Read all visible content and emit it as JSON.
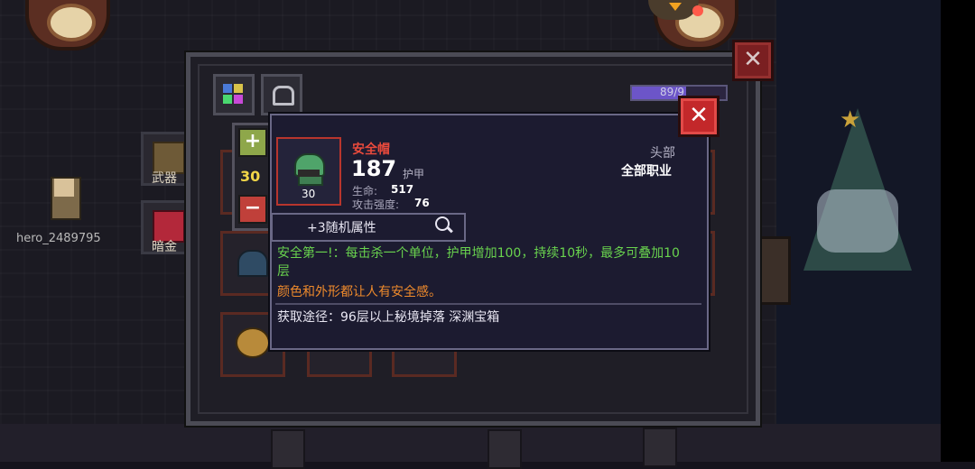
{
  "player": {
    "name": "hero_2489795"
  },
  "side_menu": {
    "weapon_label": "武器",
    "gold_label": "暗金"
  },
  "inventory": {
    "xp_text": "89/9"
  },
  "level_adjust": {
    "plus": "+",
    "minus": "−",
    "level": "30"
  },
  "tooltip": {
    "item_name": "安全帽",
    "item_level": "30",
    "armor_value": "187",
    "armor_label": "护甲",
    "stats": [
      {
        "label": "生命:",
        "value": "517"
      },
      {
        "label": "攻击强度:",
        "value": "76"
      }
    ],
    "slot": "头部",
    "class": "全部职业",
    "random_attr": "+3随机属性",
    "skill_text": "安全第一!：每击杀一个单位，护甲增加100，持续10秒，最多可叠加10层",
    "flavor_text": "颜色和外形都让人有安全感。",
    "source_text": "获取途径：96层以上秘境掉落 深渊宝箱"
  },
  "buttons": {
    "close": "✕"
  },
  "colors": {
    "item_name": "#e84a3c",
    "skill": "#69d34e",
    "flavor": "#ee8a2c",
    "level": "#f1d548",
    "close_red": "#c3282a"
  },
  "icons": {
    "helmet": "green-safety-helmet-icon",
    "magnifier": "magnifier-icon",
    "weapon": "weapon-chest-icon",
    "gold": "dark-gold-chest-icon"
  }
}
